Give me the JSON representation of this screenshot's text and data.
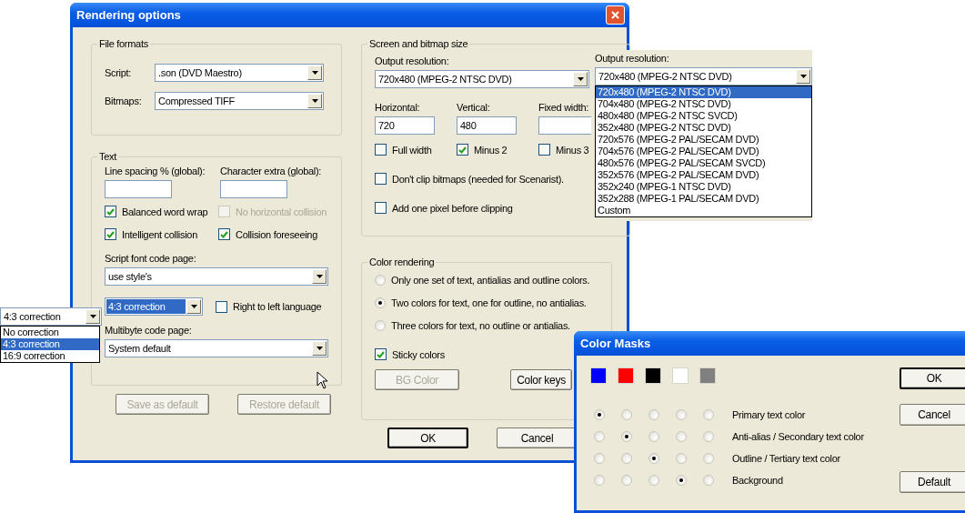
{
  "main_dialog": {
    "title": "Rendering options",
    "file_formats": {
      "title": "File formats",
      "fields": [
        {
          "label": "Script:",
          "value": ".son (DVD Maestro)"
        },
        {
          "label": "Bitmaps:",
          "value": "Compressed TIFF"
        }
      ]
    },
    "text": {
      "title": "Text",
      "inputs": [
        {
          "label": "Line spacing % (global):"
        },
        {
          "label": "Character extra (global):"
        }
      ],
      "checkboxes": [
        {
          "label": "Balanced word wrap",
          "checked": true,
          "disabled": false
        },
        {
          "label": "No horizontal collision",
          "checked": false,
          "disabled": true
        },
        {
          "label": "Intelligent collision",
          "checked": true,
          "disabled": false
        },
        {
          "label": "Collision foreseeing",
          "checked": true,
          "disabled": false
        }
      ],
      "code_page": {
        "label": "Script font code page:",
        "value": "use style's"
      },
      "correction": {
        "value": "4:3 correction",
        "focused": true
      },
      "rtl": {
        "label": "Right to left language",
        "checked": false
      },
      "multibyte": {
        "label": "Multibyte code page:",
        "value": "System default"
      }
    },
    "text_buttons": [
      {
        "label": "Save as default",
        "disabled": true
      },
      {
        "label": "Restore default",
        "disabled": true
      }
    ],
    "screen": {
      "title": "Screen and bitmap size",
      "resolution": {
        "label": "Output resolution:",
        "value": "720x480 (MPEG-2 NTSC DVD)"
      },
      "inputs": [
        {
          "label": "Horizontal:",
          "value": "720"
        },
        {
          "label": "Vertical:",
          "value": "480"
        },
        {
          "label": "Fixed width:"
        }
      ],
      "size_checks": [
        {
          "label": "Full width",
          "checked": false
        },
        {
          "label": "Minus 2",
          "checked": true
        },
        {
          "label": "Minus 3",
          "checked": false
        }
      ],
      "options": [
        {
          "label": "Don't clip bitmaps (needed for Scenarist).",
          "checked": false
        },
        {
          "label": "Add one pixel before clipping",
          "checked": false
        }
      ]
    },
    "color_rendering": {
      "title": "Color rendering",
      "modes": [
        {
          "label": "Only one set of text, antialias and outline colors.",
          "selected": false
        },
        {
          "label": "Two colors for text, one for outline, no antialias.",
          "selected": true
        },
        {
          "label": "Three colors for text, no outline or antialias.",
          "selected": false
        }
      ],
      "sticky": {
        "label": "Sticky colors",
        "checked": true
      },
      "buttons": [
        {
          "label": "BG Color",
          "disabled": true
        },
        {
          "label": "Color keys",
          "disabled": false
        }
      ]
    },
    "buttons": [
      {
        "label": "OK",
        "default": true
      },
      {
        "label": "Cancel",
        "default": false
      }
    ]
  },
  "correction_dropdown": {
    "value": "4:3 correction",
    "options": [
      {
        "label": "No correction",
        "selected": false
      },
      {
        "label": "4:3 correction",
        "selected": true
      },
      {
        "label": "16:9 correction",
        "selected": false
      }
    ]
  },
  "resolution_dropdown": {
    "label": "Output resolution:",
    "value": "720x480 (MPEG-2 NTSC DVD)",
    "options": [
      {
        "label": "720x480 (MPEG-2 NTSC DVD)",
        "selected": true
      },
      {
        "label": "704x480 (MPEG-2 NTSC DVD)",
        "selected": false
      },
      {
        "label": "480x480 (MPEG-2 NTSC SVCD)",
        "selected": false
      },
      {
        "label": "352x480 (MPEG-2 NTSC DVD)",
        "selected": false
      },
      {
        "label": "720x576 (MPEG-2 PAL/SECAM DVD)",
        "selected": false
      },
      {
        "label": "704x576 (MPEG-2 PAL/SECAM DVD)",
        "selected": false
      },
      {
        "label": "480x576 (MPEG-2 PAL/SECAM SVCD)",
        "selected": false
      },
      {
        "label": "352x576 (MPEG-2 PAL/SECAM DVD)",
        "selected": false
      },
      {
        "label": "352x240 (MPEG-1 NTSC DVD)",
        "selected": false
      },
      {
        "label": "352x288 (MPEG-1 PAL/SECAM DVD)",
        "selected": false
      },
      {
        "label": "Custom",
        "selected": false
      }
    ]
  },
  "color_masks": {
    "title": "Color Masks",
    "swatches": [
      {
        "color": "#0000ff"
      },
      {
        "color": "#ff0000"
      },
      {
        "color": "#000000"
      },
      {
        "color": "#ffffff"
      },
      {
        "color": "#808080"
      }
    ],
    "rows": [
      {
        "label": "Primary text color",
        "radios": [
          {
            "selected": true
          },
          {
            "selected": false
          },
          {
            "selected": false
          },
          {
            "selected": false
          },
          {
            "selected": false
          }
        ]
      },
      {
        "label": "Anti-alias / Secondary text color",
        "radios": [
          {
            "selected": false
          },
          {
            "selected": true
          },
          {
            "selected": false
          },
          {
            "selected": false
          },
          {
            "selected": false
          }
        ]
      },
      {
        "label": "Outline / Tertiary text color",
        "radios": [
          {
            "selected": false
          },
          {
            "selected": false
          },
          {
            "selected": true
          },
          {
            "selected": false
          },
          {
            "selected": false
          }
        ]
      },
      {
        "label": "Background",
        "radios": [
          {
            "selected": false
          },
          {
            "selected": false
          },
          {
            "selected": false
          },
          {
            "selected": true
          },
          {
            "selected": false
          }
        ]
      }
    ],
    "buttons": [
      {
        "label": "OK",
        "default": true
      },
      {
        "label": "Cancel",
        "default": false
      },
      {
        "label": "Default",
        "default": false
      }
    ]
  }
}
